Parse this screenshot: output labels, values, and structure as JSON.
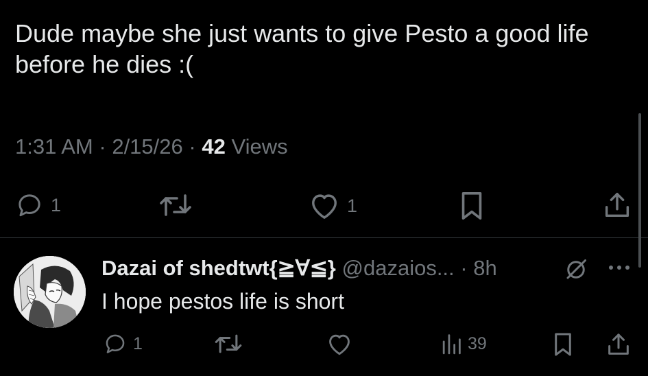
{
  "post": {
    "text": "Dude maybe she just wants to give Pesto a good life before he dies :(",
    "time": "1:31 AM",
    "date": "2/15/26",
    "separator": "·",
    "views_count": "42",
    "views_label": "Views",
    "actions": {
      "reply_icon": "reply-icon",
      "reply_count": "1",
      "repost_icon": "repost-icon",
      "like_icon": "heart-icon",
      "like_count": "1",
      "bookmark_icon": "bookmark-icon",
      "share_icon": "share-icon"
    }
  },
  "reply": {
    "display_name": "Dazai of shedtwt{≧∀≦}",
    "handle": "@dazaios...",
    "separator": "·",
    "age": "8h",
    "text": "I hope pestos life is short",
    "actions": {
      "reply_count": "1",
      "views_count": "39"
    },
    "icons": [
      "grok-icon",
      "more-icon",
      "reply-icon",
      "repost-icon",
      "heart-icon",
      "views-icon",
      "bookmark-icon",
      "share-icon"
    ]
  },
  "colors": {
    "background": "#000000",
    "primary_text": "#e7e9ea",
    "secondary_text": "#71767b",
    "divider": "#2f3336"
  }
}
